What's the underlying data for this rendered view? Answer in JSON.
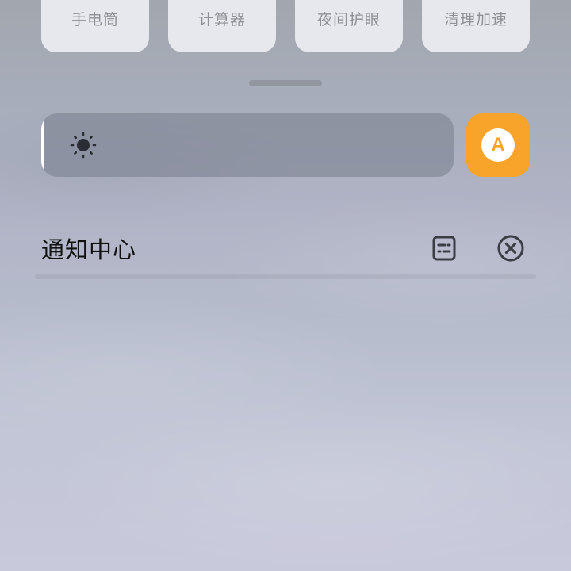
{
  "quick_tiles": [
    {
      "label": "手电筒",
      "icon": "flashlight-icon"
    },
    {
      "label": "计算器",
      "icon": "calculator-icon"
    },
    {
      "label": "夜间护眼",
      "icon": "eye-care-icon"
    },
    {
      "label": "清理加速",
      "icon": "cleanup-icon"
    }
  ],
  "brightness": {
    "level": 0.0,
    "icon": "sun-icon",
    "auto_label": "A",
    "auto_color": "#f8a42a"
  },
  "notification_center": {
    "title": "通知中心",
    "settings_icon": "notification-settings-icon",
    "clear_icon": "clear-all-icon"
  }
}
